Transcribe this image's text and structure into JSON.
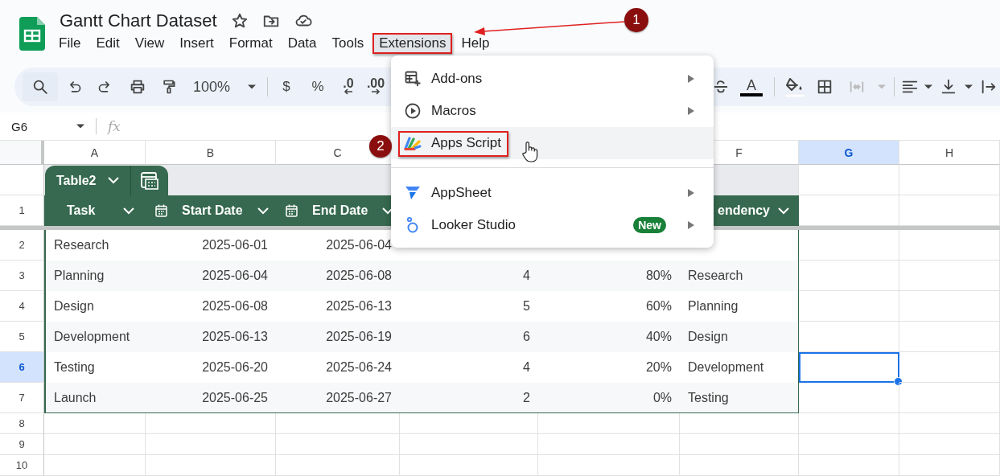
{
  "document": {
    "title": "Gantt Chart Dataset"
  },
  "menu_bar": [
    {
      "label": "File",
      "selected": false,
      "highlighted": false
    },
    {
      "label": "Edit",
      "selected": false,
      "highlighted": false
    },
    {
      "label": "View",
      "selected": false,
      "highlighted": false
    },
    {
      "label": "Insert",
      "selected": false,
      "highlighted": false
    },
    {
      "label": "Format",
      "selected": false,
      "highlighted": false
    },
    {
      "label": "Data",
      "selected": false,
      "highlighted": false
    },
    {
      "label": "Tools",
      "selected": false,
      "highlighted": false
    },
    {
      "label": "Extensions",
      "selected": true,
      "highlighted": true
    },
    {
      "label": "Help",
      "selected": false,
      "highlighted": false
    }
  ],
  "toolbar": {
    "zoom": "100%",
    "currency": "$",
    "percent": "%",
    "decrease_decimals": ".0",
    "increase_decimals": ".00",
    "text_color": "A"
  },
  "formula_bar": {
    "cell_reference": "G6",
    "function_label": "fx"
  },
  "column_headers": {
    "left": [
      {
        "letter": "A",
        "selected": false
      },
      {
        "letter": "B",
        "selected": false
      },
      {
        "letter": "C",
        "selected": false
      }
    ],
    "right": [
      {
        "letter": "F",
        "selected": false
      },
      {
        "letter": "G",
        "selected": true
      },
      {
        "letter": "H",
        "selected": false
      }
    ]
  },
  "row_headers": [
    {
      "label": "1",
      "selected": false
    },
    {
      "label": "2",
      "selected": false
    },
    {
      "label": "3",
      "selected": false
    },
    {
      "label": "4",
      "selected": false
    },
    {
      "label": "5",
      "selected": false
    },
    {
      "label": "6",
      "selected": true
    },
    {
      "label": "7",
      "selected": false
    },
    {
      "label": "8",
      "selected": false
    },
    {
      "label": "9",
      "selected": false
    },
    {
      "label": "10",
      "selected": false
    }
  ],
  "table": {
    "name": "Table2",
    "columns": [
      {
        "label": "Task",
        "kind": "text"
      },
      {
        "label": "Start Date",
        "kind": "date"
      },
      {
        "label": "End Date",
        "kind": "date"
      },
      {
        "kind": "number"
      },
      {
        "kind": "number"
      },
      {
        "label": "endency",
        "kind": "text"
      }
    ],
    "rows": [
      [
        "Research",
        "2025-06-01",
        "2025-06-04",
        null,
        null,
        null
      ],
      [
        "Planning",
        "2025-06-04",
        "2025-06-08",
        "4",
        "80%",
        "Research"
      ],
      [
        "Design",
        "2025-06-08",
        "2025-06-13",
        "5",
        "60%",
        "Planning"
      ],
      [
        "Development",
        "2025-06-13",
        "2025-06-19",
        "6",
        "40%",
        "Design"
      ],
      [
        "Testing",
        "2025-06-20",
        "2025-06-24",
        "4",
        "20%",
        "Development"
      ],
      [
        "Launch",
        "2025-06-25",
        "2025-06-27",
        "2",
        "0%",
        "Testing"
      ]
    ]
  },
  "extensions_menu": {
    "items": [
      {
        "kind": "item",
        "label": "Add-ons",
        "submenu": true,
        "selected": false,
        "highlighted": false
      },
      {
        "kind": "item",
        "label": "Macros",
        "submenu": true,
        "selected": false,
        "highlighted": false
      },
      {
        "kind": "item",
        "label": "Apps Script",
        "submenu": false,
        "selected": true,
        "highlighted": true
      },
      {
        "kind": "separator"
      },
      {
        "kind": "item",
        "label": "AppSheet",
        "submenu": true,
        "selected": false,
        "highlighted": false
      },
      {
        "kind": "item",
        "label": "Looker Studio",
        "submenu": true,
        "selected": false,
        "highlighted": false,
        "badge": "New"
      }
    ]
  },
  "annotations": [
    {
      "number": "1"
    },
    {
      "number": "2"
    }
  ]
}
